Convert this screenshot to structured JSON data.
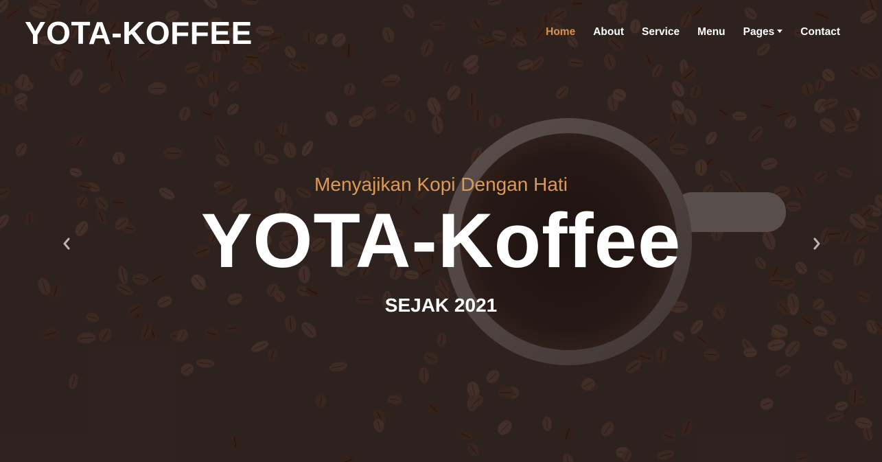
{
  "brand": {
    "name": "YOTA-KOFFEE"
  },
  "nav": {
    "items": [
      {
        "label": "Home",
        "active": true
      },
      {
        "label": "About",
        "active": false
      },
      {
        "label": "Service",
        "active": false
      },
      {
        "label": "Menu",
        "active": false
      },
      {
        "label": "Pages",
        "active": false,
        "dropdown": true
      },
      {
        "label": "Contact",
        "active": false
      }
    ]
  },
  "hero": {
    "subtitle": "Menyajikan Kopi Dengan Hati",
    "title": "YOTA-Koffee",
    "since": "SEJAK 2021"
  },
  "carousel": {
    "prev_icon": "chevron-left-icon",
    "next_icon": "chevron-right-icon"
  },
  "colors": {
    "accent": "#d9914f",
    "overlay": "#2b1f1c",
    "text": "#ffffff"
  }
}
